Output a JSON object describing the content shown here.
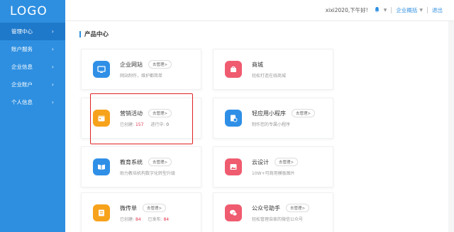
{
  "sidebar": {
    "logo": "LOGO",
    "items": [
      {
        "label": "管理中心",
        "active": true
      },
      {
        "label": "账户服务",
        "active": false
      },
      {
        "label": "企业信息",
        "active": false
      },
      {
        "label": "企业账户",
        "active": false
      },
      {
        "label": "个人信息",
        "active": false
      }
    ],
    "chevron": "›"
  },
  "topbar": {
    "greeting": "xixi2020,下午好!",
    "bell_icon": "bell-icon",
    "overview_link": "企业概括",
    "logout_link": "退出"
  },
  "main": {
    "section_title": "产品中心",
    "manage_label": "去管理>",
    "cards": [
      {
        "title": "企业网站",
        "desc": "网站制作，维护都简单",
        "icon": "monitor-icon",
        "color": "#2f8fe6"
      },
      {
        "title": "商城",
        "desc": "轻松打造在线商城",
        "icon": "shopping-bag-icon",
        "color": "#ef5b6f"
      },
      {
        "title": "营销活动",
        "icon": "calendar-icon",
        "color": "#f7a21b",
        "stat1_label": "已创建:",
        "stat1_value": "157",
        "stat2_label": "进行中:",
        "stat2_value": "0"
      },
      {
        "title": "轻应用小程序",
        "desc": "制作您的专属小程序",
        "icon": "mini-program-icon",
        "color": "#2f8fe6"
      },
      {
        "title": "教育系统",
        "desc": "助力教培机构数字化转型升级",
        "icon": "book-icon",
        "color": "#2f8fe6"
      },
      {
        "title": "云设计",
        "desc": "10W+可商用模板图片",
        "icon": "image-icon",
        "color": "#ef5b6f"
      },
      {
        "title": "微传单",
        "icon": "flyer-icon",
        "color": "#f7a21b",
        "stat1_label": "已创建:",
        "stat1_value": "84",
        "stat2_label": "已发布:",
        "stat2_value": "84"
      },
      {
        "title": "公众号助手",
        "desc": "轻松管理自家的微信公众号",
        "icon": "wechat-icon",
        "color": "#ef5b6f"
      }
    ]
  }
}
